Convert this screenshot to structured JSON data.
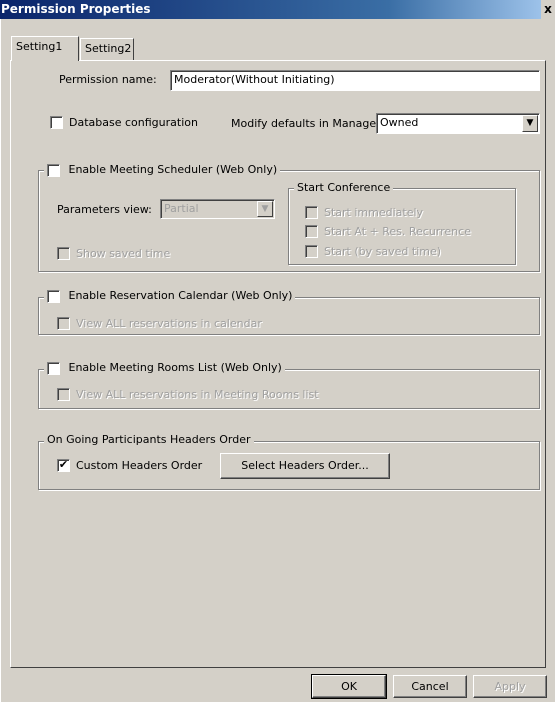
{
  "window": {
    "title": "Permission Properties",
    "close_glyph": "x"
  },
  "tabs": [
    {
      "label": "Setting1"
    },
    {
      "label": "Setting2"
    }
  ],
  "permission_name": {
    "label": "Permission name:",
    "value": "Moderator(Without Initiating)"
  },
  "database_configuration": {
    "label": "Database configuration",
    "checked": false
  },
  "modify_defaults": {
    "label": "Modify defaults in Manager:",
    "selected": "Owned"
  },
  "meeting_scheduler": {
    "label": "Enable Meeting Scheduler (Web Only)",
    "checked": false,
    "parameters_view_label": "Parameters view:",
    "parameters_view_value": "Partial",
    "show_saved_time": "Show saved time",
    "start_conference": {
      "title": "Start Conference",
      "options": [
        "Start immediately",
        "Start At + Res. Recurrence",
        "Start (by saved time)"
      ]
    }
  },
  "reservation_calendar": {
    "label": "Enable Reservation Calendar (Web Only)",
    "sub_option": "View ALL reservations in calendar"
  },
  "meeting_rooms": {
    "label": "Enable Meeting Rooms List (Web Only)",
    "sub_option": "View ALL reservations in Meeting Rooms list"
  },
  "headers_order": {
    "title": "On Going Participants Headers Order",
    "custom_label": "Custom Headers Order",
    "custom_checked": true,
    "check_glyph": "✔",
    "select_button": "Select Headers Order..."
  },
  "footer": {
    "ok": "OK",
    "cancel": "Cancel",
    "apply": "Apply"
  }
}
